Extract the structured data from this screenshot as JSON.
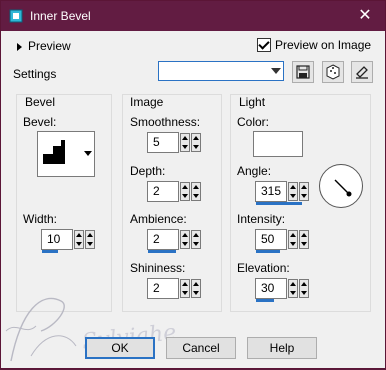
{
  "window": {
    "title": "Inner Bevel",
    "close_glyph": "✕"
  },
  "top": {
    "preview_label": "Preview",
    "preview_on_image_label": "Preview on Image",
    "preview_on_image_checked": true
  },
  "settings": {
    "label": "Settings",
    "preset_value": ""
  },
  "bevel_group": {
    "title": "Bevel",
    "bevel_label": "Bevel:",
    "width_label": "Width:",
    "width_value": "10"
  },
  "image_group": {
    "title": "Image",
    "smoothness_label": "Smoothness:",
    "smoothness_value": "5",
    "depth_label": "Depth:",
    "depth_value": "2",
    "ambience_label": "Ambience:",
    "ambience_value": "2",
    "shininess_label": "Shininess:",
    "shininess_value": "2"
  },
  "light_group": {
    "title": "Light",
    "color_label": "Color:",
    "color_value": "#ffffff",
    "angle_label": "Angle:",
    "angle_value": "315",
    "intensity_label": "Intensity:",
    "intensity_value": "50",
    "elevation_label": "Elevation:",
    "elevation_value": "30"
  },
  "buttons": {
    "ok": "OK",
    "cancel": "Cancel",
    "help": "Help"
  },
  "watermark": {
    "text": "Sylviahe"
  },
  "colors": {
    "titlebar": "#621c42",
    "accent": "#2a72c4",
    "dialog_bg": "#f0f0f0"
  }
}
